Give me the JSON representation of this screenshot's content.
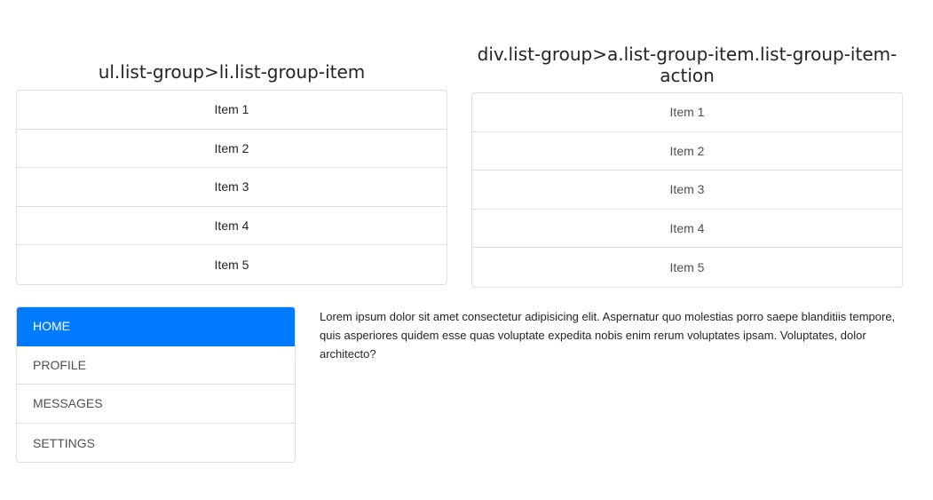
{
  "left_panel": {
    "heading": "ul.list-group>li.list-group-item",
    "items": [
      "Item 1",
      "Item 2",
      "Item 3",
      "Item 4",
      "Item 5"
    ]
  },
  "right_panel": {
    "heading_line1": "div.list-group>a.list-group-item.list-group-item-",
    "heading_line2": "action",
    "items": [
      "Item 1",
      "Item 2",
      "Item 3",
      "Item 4",
      "Item 5"
    ]
  },
  "nav": {
    "items": [
      "HOME",
      "PROFILE",
      "MESSAGES",
      "SETTINGS"
    ],
    "active_index": 0
  },
  "content": {
    "paragraph": "Lorem ipsum dolor sit amet consectetur adipisicing elit. Aspernatur quo molestias porro saepe blanditiis tempore, quis asperiores quidem esse quas voluptate expedita nobis enim rerum voluptates ipsam. Voluptates, dolor architecto?"
  },
  "colors": {
    "accent": "#007bff",
    "border": "rgba(0,0,0,0.125)"
  }
}
